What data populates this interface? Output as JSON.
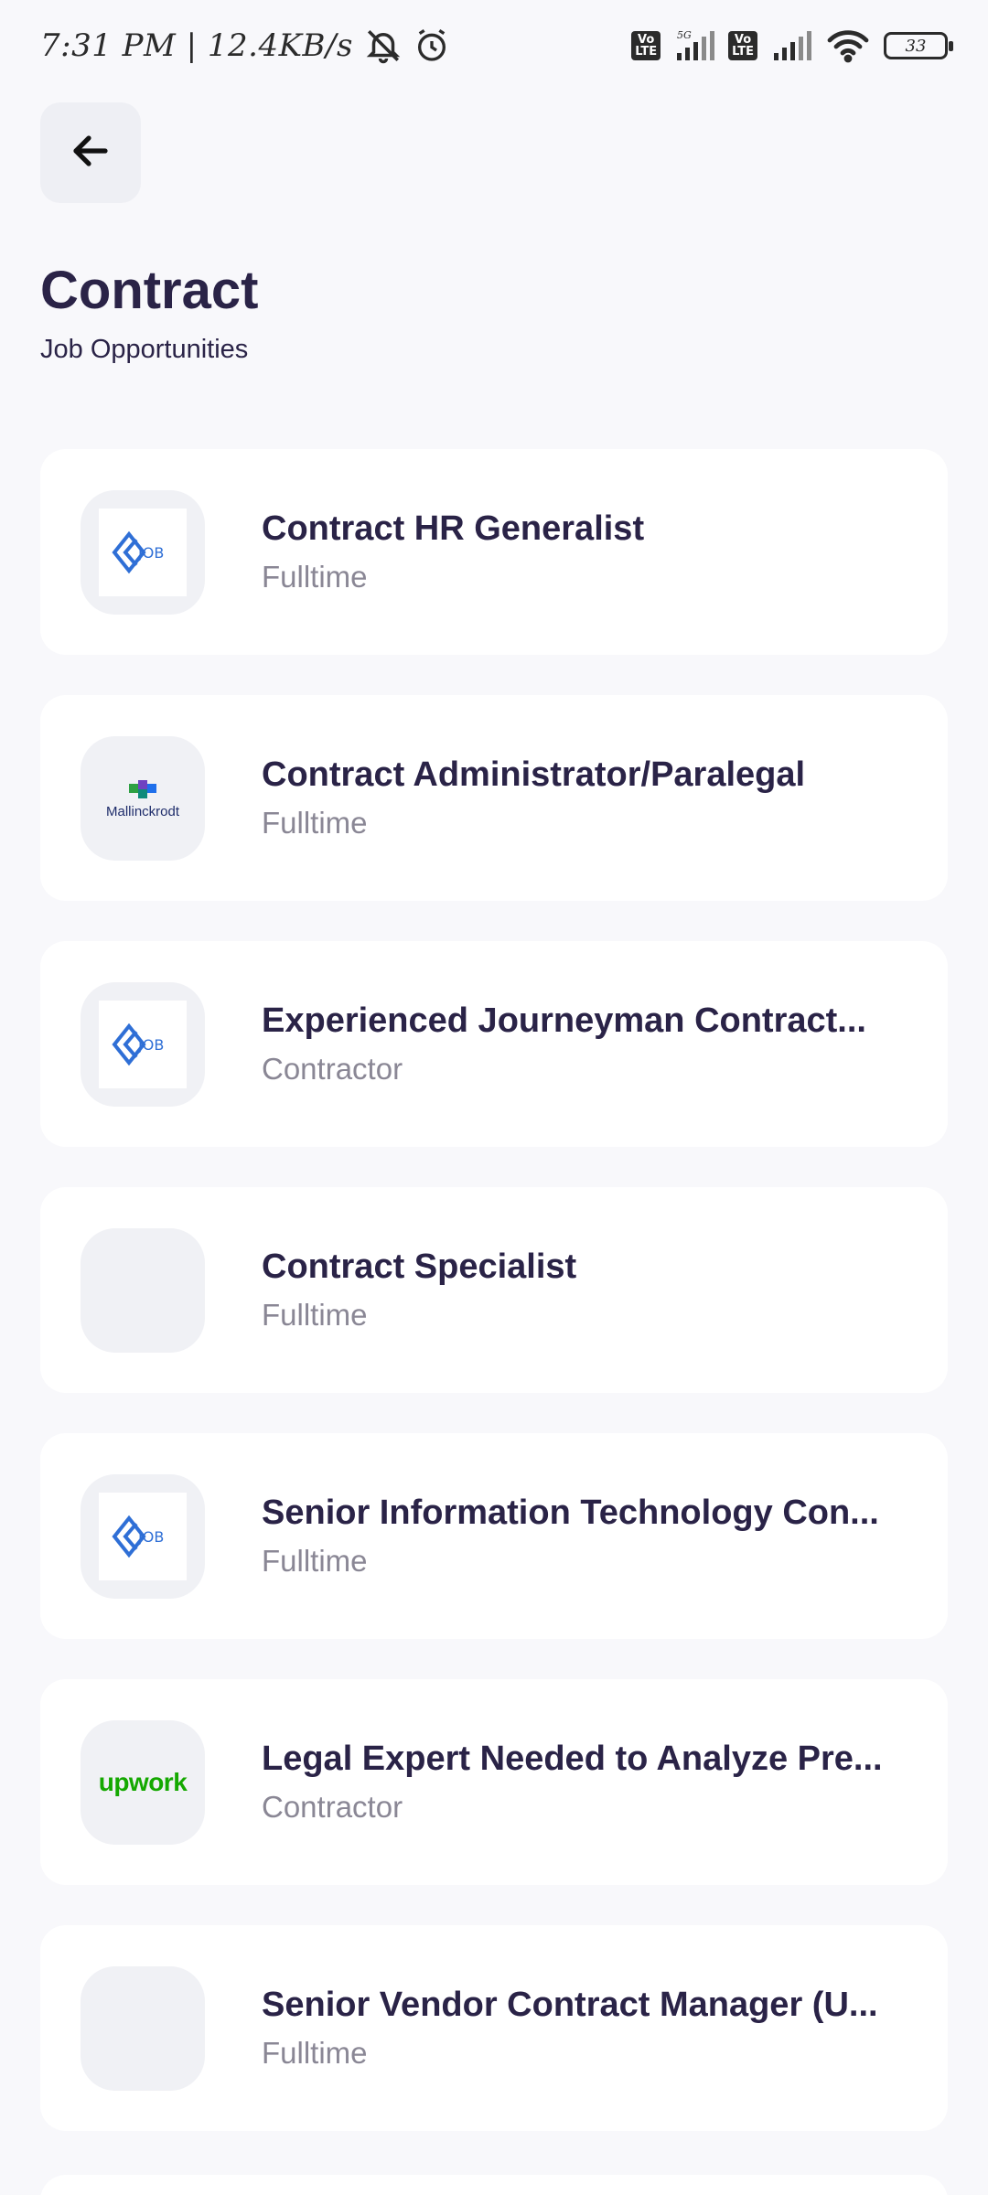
{
  "status_bar": {
    "time": "7:31 PM | 12.4KB/s",
    "network": "5G",
    "volte_label": "Vo\nLTE",
    "battery": "33"
  },
  "header": {
    "back_icon": "arrow-left-icon",
    "title": "Contract",
    "subtitle": "Job Opportunities"
  },
  "jobs": [
    {
      "title": "Contract HR Generalist",
      "type": "Fulltime",
      "logo": "job-logo-icon"
    },
    {
      "title": "Contract Administrator/Paralegal",
      "type": "Fulltime",
      "logo": "mallinckrodt-logo",
      "logo_text": "Mallinckrodt"
    },
    {
      "title": "Experienced Journeyman Contract...",
      "type": "Contractor",
      "logo": "job-logo-icon"
    },
    {
      "title": "Contract Specialist",
      "type": "Fulltime",
      "logo": "none"
    },
    {
      "title": "Senior Information Technology Con...",
      "type": "Fulltime",
      "logo": "job-logo-icon"
    },
    {
      "title": "Legal Expert Needed to Analyze Pre...",
      "type": "Contractor",
      "logo": "upwork-logo",
      "logo_text": "upwork"
    },
    {
      "title": "Senior Vendor Contract Manager (U...",
      "type": "Fulltime",
      "logo": "none"
    }
  ],
  "colors": {
    "background": "#f8f8fb",
    "card": "#ffffff",
    "title": "#2a2347",
    "muted": "#8a8795",
    "job_logo_blue": "#2f6fd6",
    "upwork_green": "#14a800"
  }
}
